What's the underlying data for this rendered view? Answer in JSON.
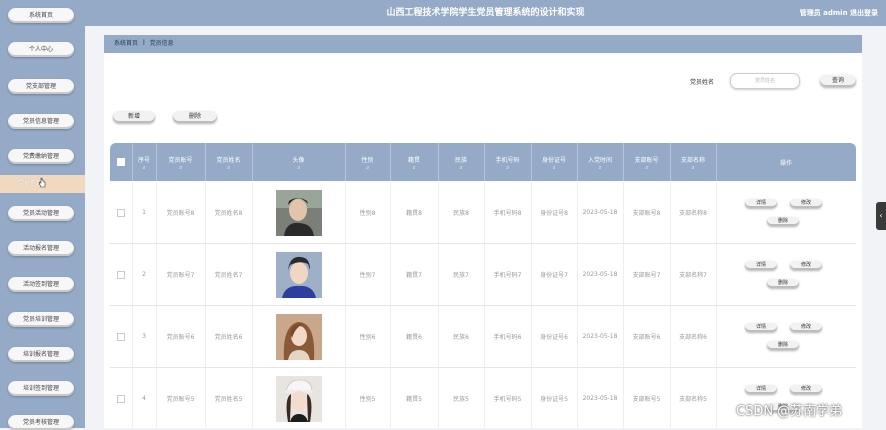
{
  "app": {
    "title": "山西工程技术学院学生党员管理系统的设计和实现",
    "user": "管理员 admin 退出登录"
  },
  "sidebar": {
    "items": [
      {
        "label": "系统首页"
      },
      {
        "label": "个人中心"
      },
      {
        "label": "党支部管理"
      },
      {
        "label": "党员信息管理"
      },
      {
        "label": "党费缴纳管理"
      },
      {
        "label": "党员活动管理"
      },
      {
        "label": "活动报名管理"
      },
      {
        "label": "活动签到管理"
      },
      {
        "label": "党员培训管理"
      },
      {
        "label": "培训报名管理"
      },
      {
        "label": "培训签到管理"
      },
      {
        "label": "党员考核管理"
      }
    ],
    "active": "党员信息"
  },
  "breadcrumb": {
    "home": "系统首页",
    "sep": "ꟾ",
    "current": "党员信息"
  },
  "search": {
    "label": "党员姓名",
    "placeholder": "党员姓名",
    "button": "查询"
  },
  "toolbar": {
    "add": "新增",
    "delete": "删除"
  },
  "table": {
    "headers": [
      "序号",
      "党员账号",
      "党员姓名",
      "头像",
      "性别",
      "籍贯",
      "民族",
      "手机号码",
      "身份证号",
      "入党时间",
      "支部账号",
      "支部名称",
      "操作"
    ],
    "sort_mark": "⇵",
    "rows": [
      {
        "no": "1",
        "account": "党员账号8",
        "name": "党员姓名8",
        "gender": "性别8",
        "origin": "籍贯8",
        "ethnic": "民族8",
        "phone": "手机号码8",
        "idcard": "身份证号8",
        "joined": "2023-05-18",
        "branch_acct": "支部账号8",
        "branch_name": "支部名称8"
      },
      {
        "no": "2",
        "account": "党员账号7",
        "name": "党员姓名7",
        "gender": "性别7",
        "origin": "籍贯7",
        "ethnic": "民族7",
        "phone": "手机号码7",
        "idcard": "身份证号7",
        "joined": "2023-05-18",
        "branch_acct": "支部账号7",
        "branch_name": "支部名称7"
      },
      {
        "no": "3",
        "account": "党员账号6",
        "name": "党员姓名6",
        "gender": "性别6",
        "origin": "籍贯6",
        "ethnic": "民族6",
        "phone": "手机号码6",
        "idcard": "身份证号6",
        "joined": "2023-05-18",
        "branch_acct": "支部账号6",
        "branch_name": "支部名称6"
      },
      {
        "no": "4",
        "account": "党员账号5",
        "name": "党员姓名5",
        "gender": "性别5",
        "origin": "籍贯5",
        "ethnic": "民族5",
        "phone": "手机号码5",
        "idcard": "身份证号5",
        "joined": "2023-05-18",
        "branch_acct": "支部账号5",
        "branch_name": "支部名称5"
      }
    ],
    "actions": {
      "detail": "详情",
      "edit": "修改",
      "remove": "删除"
    }
  },
  "watermark": "CSDN @苏南学弟",
  "colors": {
    "primary": "#94aac6",
    "active": "#f0d9bf"
  }
}
